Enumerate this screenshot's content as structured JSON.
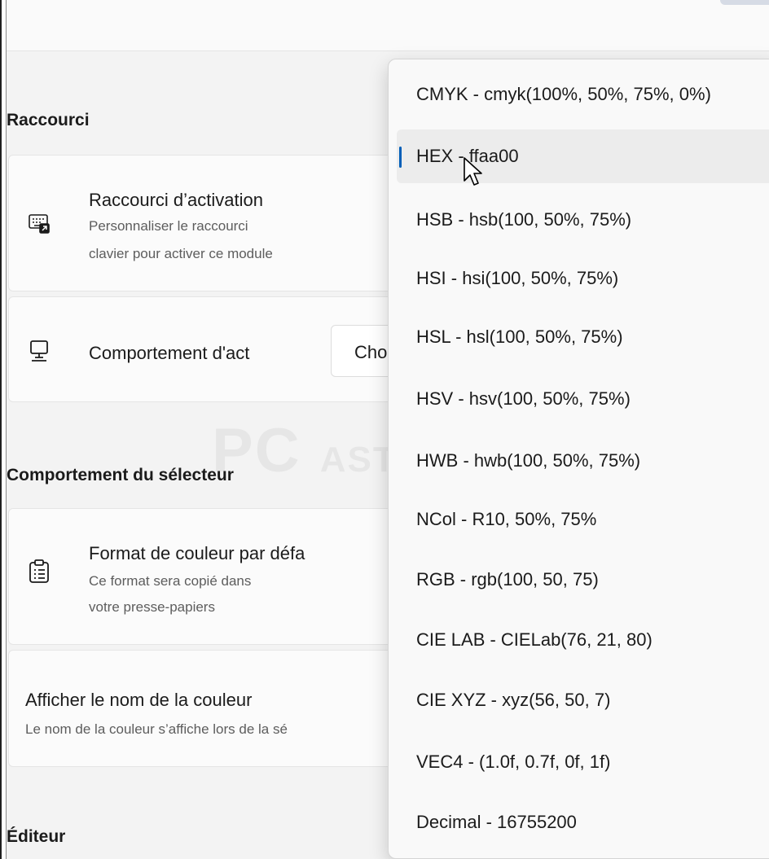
{
  "sections": {
    "shortcut": "Raccourci",
    "picker_behavior": "Comportement du sélecteur",
    "editor": "Éditeur"
  },
  "activation_shortcut": {
    "title": "Raccourci d’activation",
    "desc_line1": "Personnaliser le raccourci",
    "desc_line2": "clavier pour activer ce module"
  },
  "activation_behavior": {
    "title": "Comportement d'act",
    "combo_value": "Choi"
  },
  "default_format": {
    "title": "Format de couleur par défa",
    "desc_line1": "Ce format sera copié dans",
    "desc_line2": "votre presse-papiers"
  },
  "show_color_name": {
    "title": "Afficher le nom de la couleur",
    "desc": "Le nom de la couleur s’affiche lors de la sé"
  },
  "watermark": {
    "big": "PC",
    "small": "ASTUCES"
  },
  "dropdown": {
    "selected_index": 1,
    "options": [
      "CMYK - cmyk(100%, 50%, 75%, 0%)",
      "HEX - ffaa00",
      "HSB - hsb(100, 50%, 75%)",
      "HSI - hsi(100, 50%, 75%)",
      "HSL - hsl(100, 50%, 75%)",
      "HSV - hsv(100, 50%, 75%)",
      "HWB - hwb(100, 50%, 75%)",
      "NCol - R10, 50%, 75%",
      "RGB - rgb(100, 50, 75)",
      "CIE LAB - CIELab(76, 21, 80)",
      "CIE XYZ - xyz(56, 50, 7)",
      "VEC4 - (1.0f, 0.7f, 0f, 1f)",
      "Decimal - 16755200"
    ]
  },
  "colors": {
    "accent": "#005fb8",
    "background": "#f3f3f3",
    "card": "#fbfbfb"
  }
}
